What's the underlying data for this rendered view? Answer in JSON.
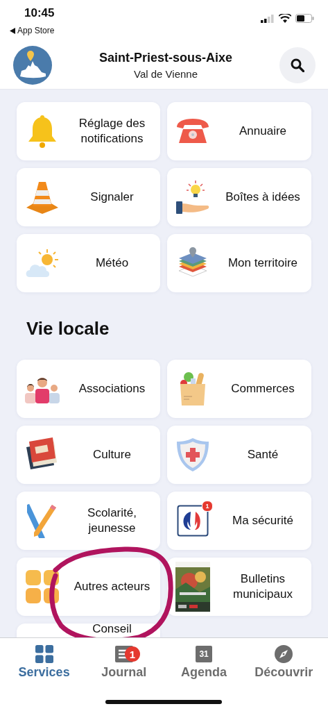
{
  "status_bar": {
    "time": "10:45",
    "back_label": "App Store"
  },
  "header": {
    "title": "Saint-Priest-sous-Aixe",
    "subtitle": "Val de Vienne"
  },
  "services": [
    {
      "label": "Réglage des notifications"
    },
    {
      "label": "Annuaire"
    },
    {
      "label": "Signaler"
    },
    {
      "label": "Boîtes à idées"
    },
    {
      "label": "Météo"
    },
    {
      "label": "Mon territoire"
    }
  ],
  "local_section": {
    "title": "Vie locale",
    "items": [
      {
        "label": "Associations"
      },
      {
        "label": "Commerces"
      },
      {
        "label": "Culture"
      },
      {
        "label": "Santé"
      },
      {
        "label": "Scolarité, jeunesse"
      },
      {
        "label": "Ma sécurité",
        "badge": "1"
      },
      {
        "label": "Autres acteurs"
      },
      {
        "label": "Bulletins municipaux",
        "kind": "picture"
      },
      {
        "label": "Conseil",
        "kind": "partial"
      }
    ]
  },
  "annotations": [
    {
      "kind": "circle"
    }
  ],
  "tabs": [
    {
      "label": "Services",
      "selected": true
    },
    {
      "label": "Journal",
      "selected": false,
      "badge": "1"
    },
    {
      "label": "Agenda",
      "selected": false,
      "icon_text": "31"
    },
    {
      "label": "Découvrir",
      "selected": false
    }
  ]
}
